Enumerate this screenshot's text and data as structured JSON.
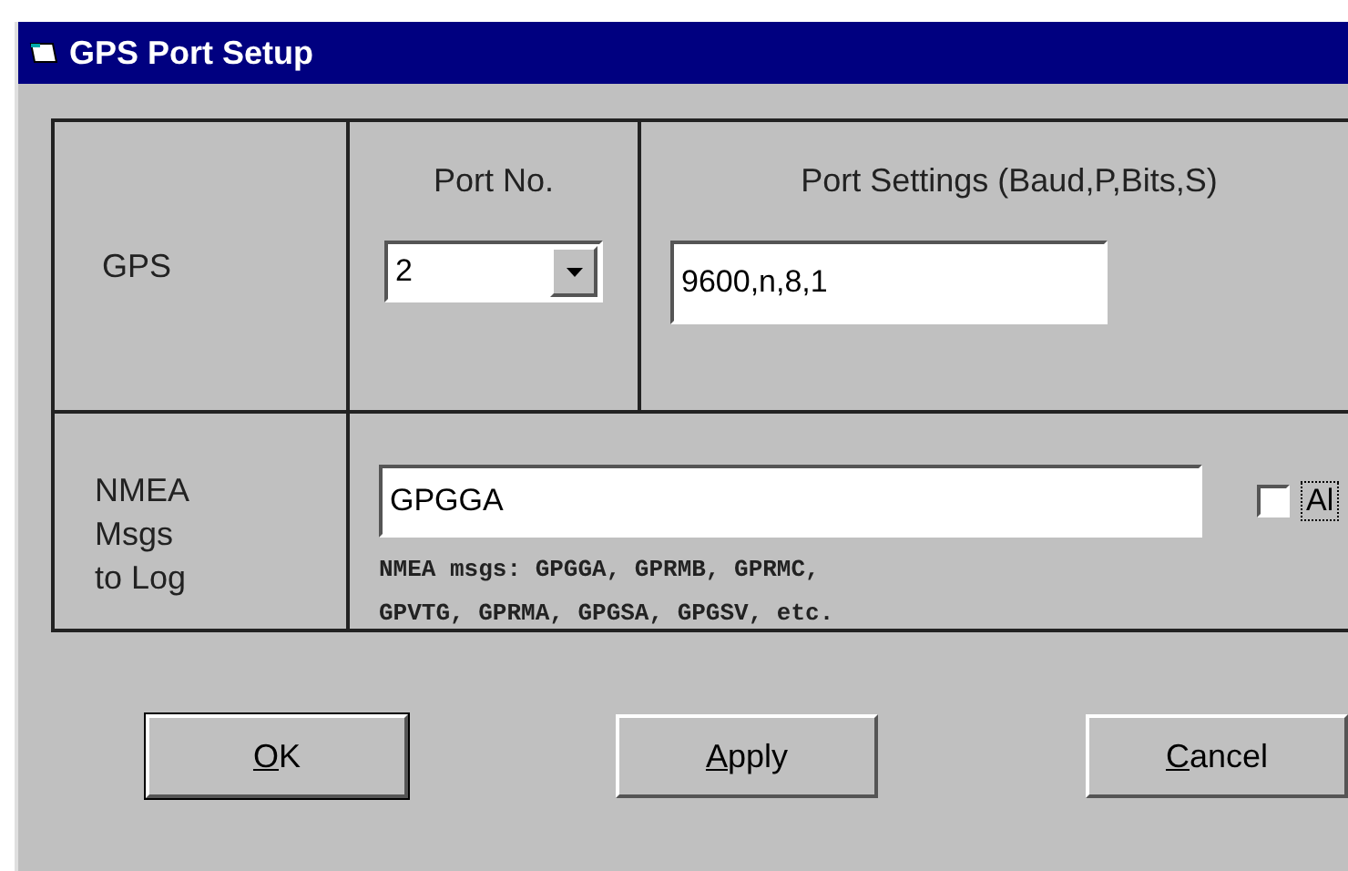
{
  "window": {
    "title": "GPS Port Setup"
  },
  "gps_row": {
    "label": "GPS",
    "port_heading": "Port No.",
    "port_value": "2",
    "settings_heading": "Port Settings (Baud,P,Bits,S)",
    "settings_value": "9600,n,8,1"
  },
  "nmea_row": {
    "label": "NMEA\nMsgs\nto Log",
    "value": "GPGGA",
    "hint": "NMEA msgs: GPGGA, GPRMB, GPRMC,\nGPVTG, GPRMA, GPGSA, GPGSV, etc.",
    "checkbox": {
      "label": "Al",
      "checked": false
    }
  },
  "buttons": [
    {
      "label": "OK",
      "default": true
    },
    {
      "label": "Apply",
      "default": false
    },
    {
      "label": "Cancel",
      "default": false
    }
  ]
}
